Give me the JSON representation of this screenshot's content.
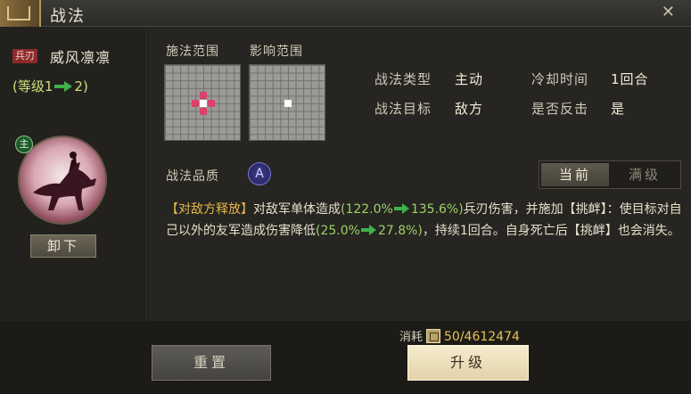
{
  "window": {
    "title": "战法",
    "close_glyph": "✕"
  },
  "skill": {
    "tag": "兵刃",
    "name": "威风凛凛",
    "level_prefix": "(等级1",
    "level_suffix": "2)",
    "main_badge": "主",
    "unequip_label": "卸下"
  },
  "ranges": {
    "cast_label": "施法范围",
    "effect_label": "影响范围"
  },
  "attributes": {
    "type_label": "战法类型",
    "type_value": "主动",
    "cooldown_label": "冷却时间",
    "cooldown_value": "1回合",
    "target_label": "战法目标",
    "target_value": "敌方",
    "counter_label": "是否反击",
    "counter_value": "是"
  },
  "quality": {
    "label": "战法品质",
    "grade": "A"
  },
  "toggle": {
    "current": "当前",
    "max": "满级"
  },
  "description": {
    "tag": "【对敌方释放】",
    "t1": "对敌军单体造成",
    "v1_open": "(122.0%",
    "v1_close": "135.6%)",
    "t2": "兵刃伤害，并施加【挑衅】：使目标对自己以外的友军造成伤害降低",
    "v2_open": "(25.0%",
    "v2_close": "27.8%)",
    "t3": "，持续1回合。自身死亡后【挑衅】也会消失。"
  },
  "footer": {
    "reset_label": "重置",
    "cost_label": "消耗",
    "cost_value": "50/4612474",
    "upgrade_label": "升级"
  },
  "icons": {
    "title": "ornament-icon",
    "cost": "resource-icon",
    "arrow": "green-arrow-icon"
  },
  "colors": {
    "highlight_gold": "#e5b64e",
    "highlight_green": "#9ed069",
    "range_hit": "#d8436a"
  }
}
